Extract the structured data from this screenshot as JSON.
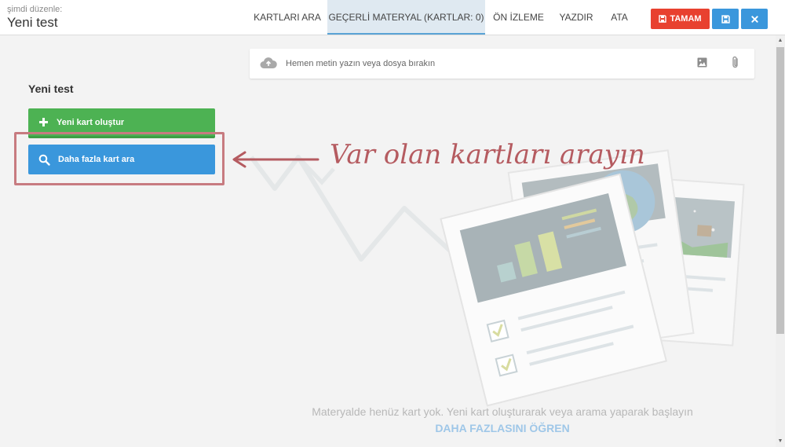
{
  "header": {
    "subtitle": "şimdi düzenle:",
    "title": "Yeni test",
    "tabs": [
      {
        "label": "KARTLARI ARA",
        "active": false
      },
      {
        "label": "GEÇERLİ MATERYAL (KARTLAR: 0)",
        "active": true
      },
      {
        "label": "ÖN İZLEME",
        "active": false
      },
      {
        "label": "YAZDIR",
        "active": false
      },
      {
        "label": "ATA",
        "active": false
      }
    ],
    "buttons": {
      "confirm_label": "TAMAM",
      "confirm_icon": "save-icon",
      "save_icon": "save-icon",
      "close_icon": "close-icon"
    }
  },
  "upload": {
    "placeholder": "Hemen metin yazın veya dosya bırakın",
    "icons": [
      "cloud-upload-icon",
      "image-icon",
      "paperclip-icon"
    ]
  },
  "left_panel": {
    "title": "Yeni test",
    "new_card_label": "Yeni kart oluştur",
    "search_label": "Daha fazla kart ara"
  },
  "annotation": {
    "text": "Var olan kartları arayın"
  },
  "empty_state": {
    "message": "Materyalde henüz kart yok. Yeni kart oluşturarak veya arama yaparak başlayın",
    "learn_more": "DAHA FAZLASINI ÖĞREN"
  },
  "colors": {
    "red": "#e8412f",
    "blue": "#3a97dc",
    "green": "#4db253",
    "annotation": "#b55b60"
  }
}
